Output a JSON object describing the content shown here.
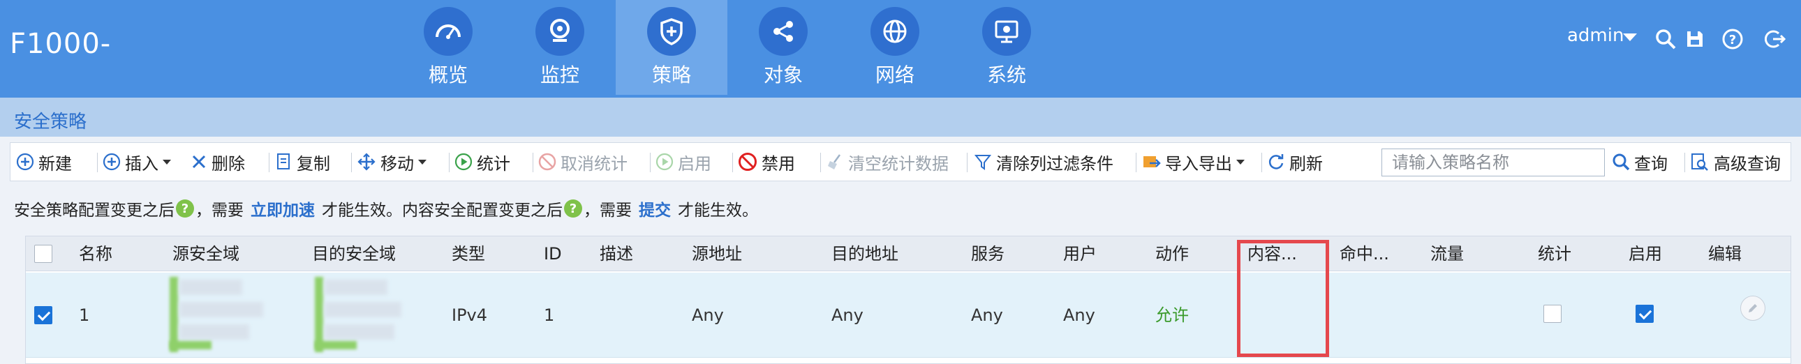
{
  "app": {
    "title": "F1000-"
  },
  "nav": [
    {
      "label": "概览",
      "icon": "dashboard-gauge-icon"
    },
    {
      "label": "监控",
      "icon": "webcam-monitor-icon"
    },
    {
      "label": "策略",
      "icon": "shield-plus-icon",
      "active": true
    },
    {
      "label": "对象",
      "icon": "share-nodes-icon"
    },
    {
      "label": "网络",
      "icon": "globe-icon"
    },
    {
      "label": "系统",
      "icon": "monitor-settings-icon"
    }
  ],
  "header_right": {
    "user": "admin",
    "icons": [
      "search-icon",
      "save-icon",
      "help-icon",
      "logout-icon"
    ]
  },
  "section": {
    "title": "安全策略"
  },
  "toolbar": {
    "new": "新建",
    "insert": "插入",
    "delete": "删除",
    "copy": "复制",
    "move": "移动",
    "stats": "统计",
    "cancel_stats": "取消统计",
    "enable": "启用",
    "disable": "禁用",
    "clear_stats": "清空统计数据",
    "clear_filters": "清除列过滤条件",
    "import_export": "导入导出",
    "refresh": "刷新",
    "search_placeholder": "请输入策略名称",
    "query": "查询",
    "advanced_query": "高级查询"
  },
  "notice": {
    "part1": "安全策略配置变更之后",
    "part2": "，需要",
    "link1": "立即加速",
    "part3": "才能生效。内容安全配置变更之后",
    "part4": "，需要",
    "link2": "提交",
    "part5": "才能生效。"
  },
  "table": {
    "columns": [
      "名称",
      "源安全域",
      "目的安全域",
      "类型",
      "ID",
      "描述",
      "源地址",
      "目的地址",
      "服务",
      "用户",
      "动作",
      "内容...",
      "命中...",
      "流量",
      "统计",
      "启用",
      "编辑"
    ],
    "rows": [
      {
        "selected": true,
        "name": "1",
        "type": "IPv4",
        "id": "1",
        "description": "",
        "src_addr": "Any",
        "dst_addr": "Any",
        "service": "Any",
        "user": "Any",
        "action": "允许",
        "content": "",
        "hit": "",
        "traffic": "",
        "stats_checked": false,
        "enabled": true
      }
    ]
  },
  "colors": {
    "header_bg": "#4a90e2",
    "nav_active_bg": "#6fa8ea",
    "accent": "#2b6fcc",
    "allow": "#3a9a2a",
    "highlight_box": "#e5484d"
  }
}
